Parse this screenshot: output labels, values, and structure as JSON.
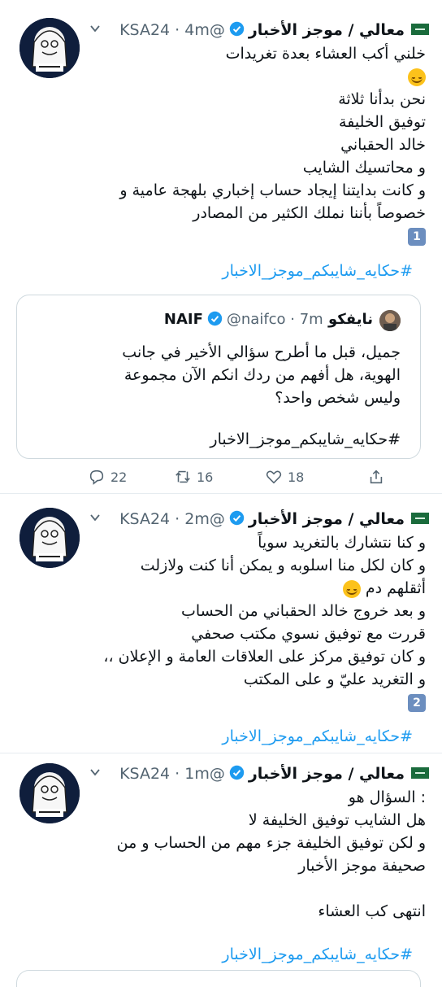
{
  "tweets": [
    {
      "name": "معالي / موجز الأخبار",
      "handle": "@KSA24",
      "time": "4m",
      "lines": [
        "خلني أكب العشاء بعدة تغريدات",
        "",
        "نحن بدأنا ثلاثة",
        "توفيق الخليفة",
        "خالد الحقباني",
        "و محاتسيك الشايب",
        "و كانت بدايتنا إيجاد حساب إخباري بلهجة عامية و",
        "خصوصاً بأننا نملك الكثير من المصادر",
        ""
      ],
      "keycap": "1",
      "hashtag": "#حكايه_شايبكم_موجز_الاخبار",
      "quote": {
        "name": "نايفكو NAIF",
        "handle": "@naifco",
        "time": "7m",
        "lines": [
          "جميل، قبل ما أطرح سؤالي الأخير في جانب",
          "الهوية، هل أفهم من ردك انكم الآن مجموعة",
          "وليس شخص واحد؟"
        ],
        "hashtag": "#حكايه_شايبكم_موجز_الاخبار"
      },
      "actions": {
        "replies": "22",
        "retweets": "16",
        "likes": "18"
      }
    },
    {
      "name": "معالي / موجز الأخبار",
      "handle": "@KSA24",
      "time": "2m",
      "lines": [
        "و كنا نتشارك بالتغريد سوياً",
        "و كان لكل منا اسلوبه و يمكن أنا كنت ولازلت",
        "أثقلهم دم",
        "و بعد خروج خالد الحقباني من الحساب",
        "قررت مع توفيق نسوي مكتب صحفي",
        "و كان توفيق مركز على العلاقات العامة و الإعلان ،،",
        "و التغريد عليّ و على المكتب"
      ],
      "keycap": "2",
      "hashtag": "#حكايه_شايبكم_موجز_الاخبار"
    },
    {
      "name": "معالي / موجز الأخبار",
      "handle": "@KSA24",
      "time": "1m",
      "lines": [
        ": السؤال هو",
        "هل الشايب توفيق الخليفة لا",
        "و لكن توفيق الخليفة جزء مهم من الحساب و من",
        "صحيفة موجز الأخبار",
        "",
        "انتهى كب العشاء"
      ],
      "hashtag": "#حكايه_شايبكم_موجز_الاخبار"
    }
  ],
  "colors": {
    "accent": "#1d9bf0",
    "secondary": "#536471",
    "divider": "#e6ecf0"
  },
  "icons": [
    "saudi-flag-icon",
    "verified-badge-icon",
    "chevron-down-icon",
    "reply-icon",
    "retweet-icon",
    "like-icon",
    "relaxed-face-emoji",
    "smirk-face-emoji",
    "keycap-icon"
  ]
}
